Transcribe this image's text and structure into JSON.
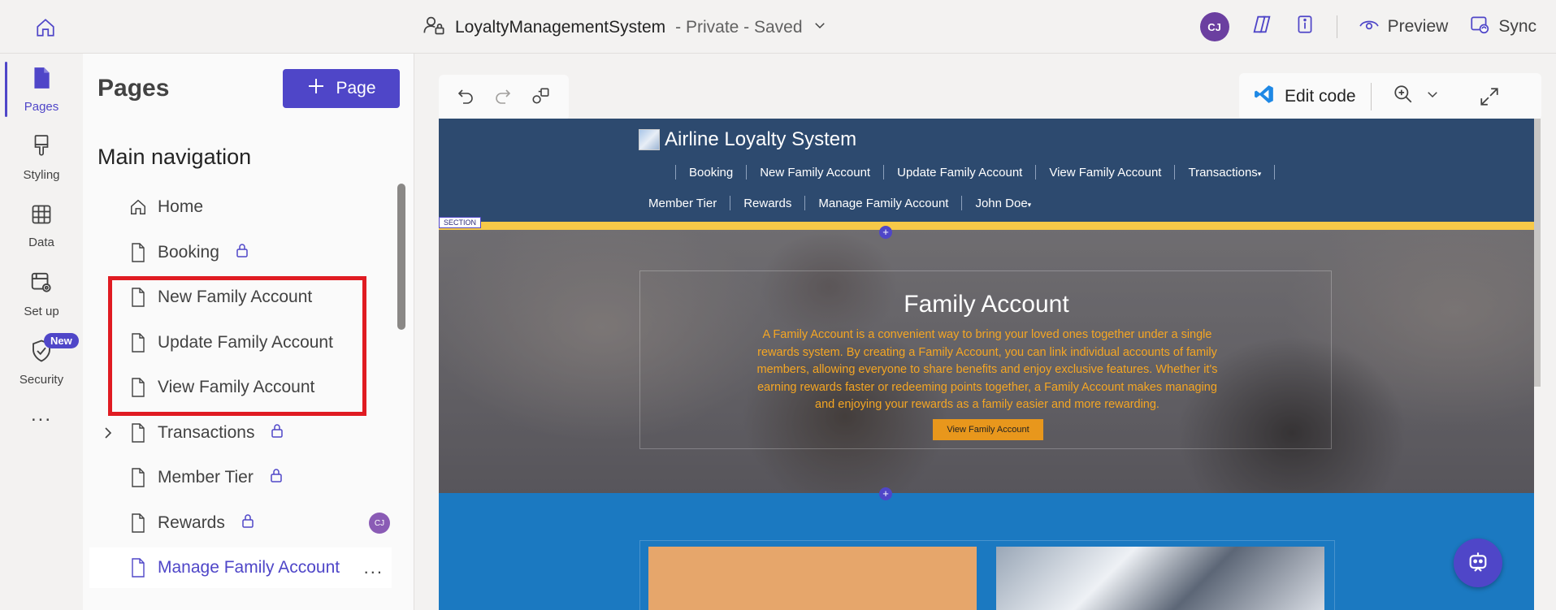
{
  "topbar": {
    "app_name": "LoyaltyManagementSystem",
    "status": "- Private - Saved",
    "avatar_initials": "CJ",
    "preview_label": "Preview",
    "sync_label": "Sync"
  },
  "rail": {
    "items": [
      {
        "label": "Pages",
        "icon": "page-icon"
      },
      {
        "label": "Styling",
        "icon": "paintbrush-icon"
      },
      {
        "label": "Data",
        "icon": "table-icon"
      },
      {
        "label": "Set up",
        "icon": "settings-icon"
      },
      {
        "label": "Security",
        "icon": "shield-icon",
        "badge": "New"
      }
    ],
    "more": "..."
  },
  "panel": {
    "title": "Pages",
    "add_button": "Page",
    "section_title": "Main navigation",
    "items": [
      {
        "label": "Home",
        "icon": "home-icon"
      },
      {
        "label": "Booking",
        "icon": "page-icon",
        "locked": true
      },
      {
        "label": "New Family Account",
        "icon": "page-icon"
      },
      {
        "label": "Update Family Account",
        "icon": "page-icon"
      },
      {
        "label": "View Family Account",
        "icon": "page-icon"
      },
      {
        "label": "Transactions",
        "icon": "page-icon",
        "locked": true,
        "expandable": true
      },
      {
        "label": "Member Tier",
        "icon": "page-icon",
        "locked": true
      },
      {
        "label": "Rewards",
        "icon": "page-icon",
        "locked": true,
        "presence": "CJ"
      },
      {
        "label": "Manage Family Account",
        "icon": "page-icon",
        "selected": true,
        "more": "..."
      }
    ]
  },
  "canvas_toolbar": {
    "edit_code": "Edit code"
  },
  "site": {
    "logo_text": "Airline Loyalty System",
    "nav_row1": [
      "Booking",
      "New Family Account",
      "Update Family Account",
      "View Family Account",
      "Transactions"
    ],
    "nav_row2": [
      "Member Tier",
      "Rewards",
      "Manage Family Account",
      "John Doe"
    ],
    "section_tag": "SECTION",
    "hero": {
      "title": "Family Account",
      "text": "A Family Account is a convenient way to bring your loved ones together under a single rewards system. By creating a Family Account, you can link individual accounts of family members, allowing everyone to share benefits and enjoy exclusive features. Whether it's earning rewards faster or redeeming points together, a Family Account makes managing and enjoying your rewards as a family easier and more rewarding.",
      "button": "View Family Account"
    }
  },
  "colors": {
    "accent": "#4f46c8",
    "site_header": "#2d4a6f",
    "site_blue": "#1b79c1",
    "hero_text": "#f5a623",
    "highlight": "#e01b22"
  }
}
